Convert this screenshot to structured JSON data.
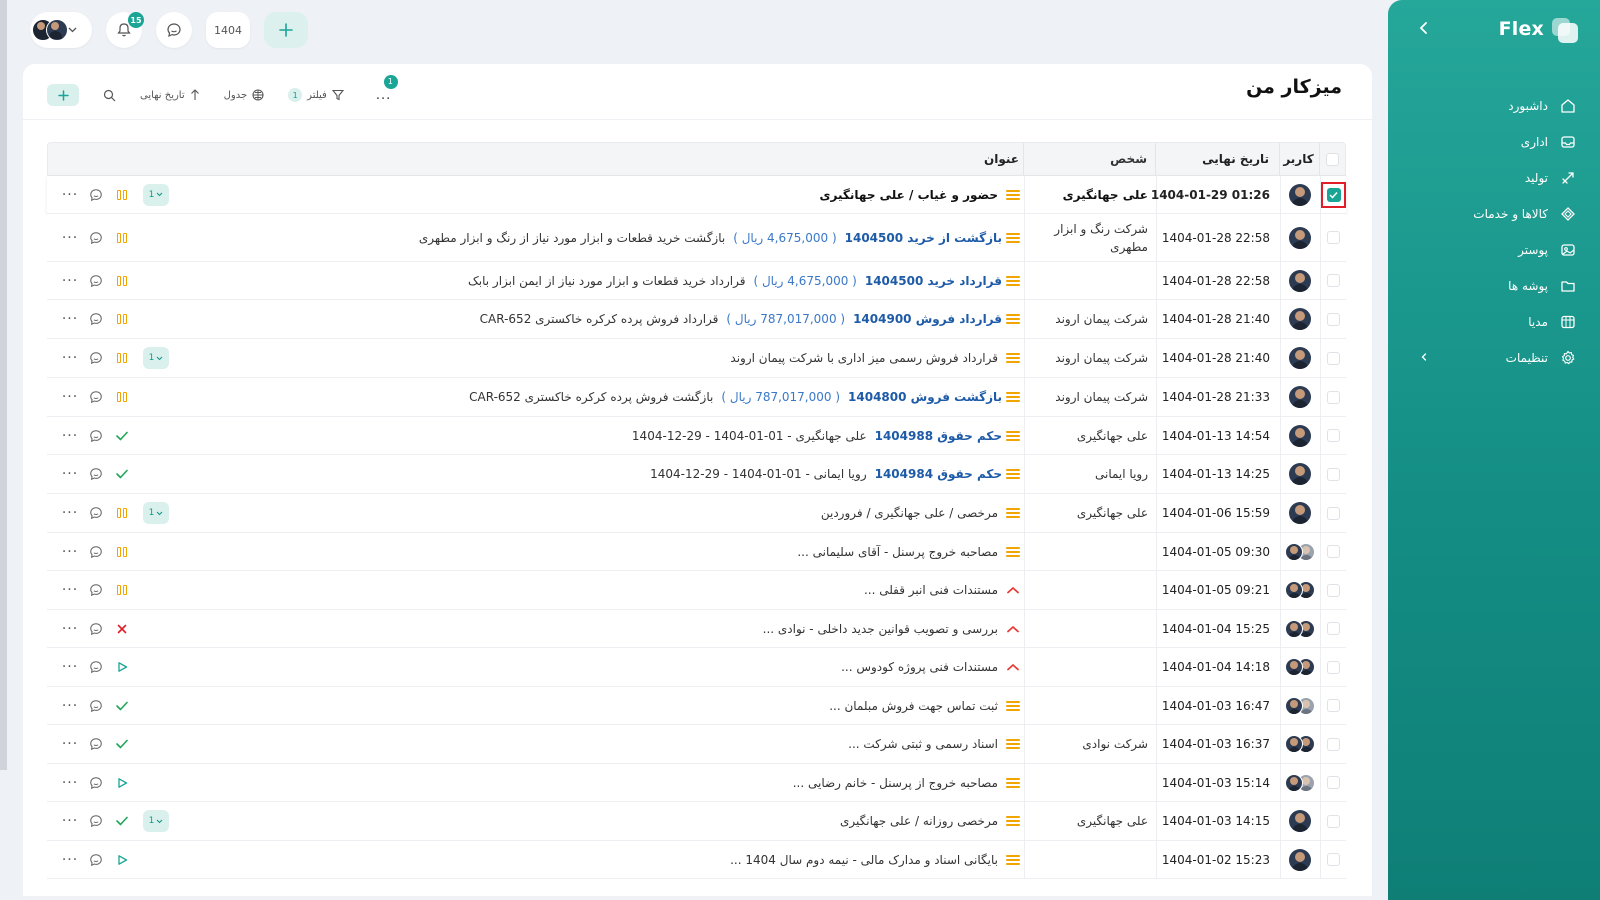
{
  "sidebar": {
    "logo": "Flex",
    "items": [
      {
        "label": "داشبورد",
        "icon": "home-icon"
      },
      {
        "label": "اداری",
        "icon": "inbox-icon"
      },
      {
        "label": "تولید",
        "icon": "production-icon"
      },
      {
        "label": "کالاها و خدمات",
        "icon": "boxes-icon"
      },
      {
        "label": "پوستر",
        "icon": "image-icon"
      },
      {
        "label": "پوشه ها",
        "icon": "folder-icon"
      },
      {
        "label": "مدیا",
        "icon": "media-icon"
      },
      {
        "label": "تنظیمات",
        "icon": "gear-icon"
      }
    ]
  },
  "topbar": {
    "notifications_count": "15",
    "year": "1404"
  },
  "page": {
    "title": "میزکار من"
  },
  "toolbar": {
    "sort_label": "تاریخ نهایی",
    "view_label": "جدول",
    "filter_label": "فیلتر",
    "filter_count": "1",
    "more_label": "...",
    "more_badge": "1"
  },
  "table": {
    "headers": {
      "user": "کاربر",
      "date": "تاریخ نهایی",
      "person": "شخص",
      "title": "عنوان"
    },
    "rows": [
      {
        "date": "1404-01-29 01:26",
        "person": "علی جهانگیری",
        "title": "حضور و غیاب / علی جهانگیری",
        "status": "pause",
        "sub": "1",
        "selected": true,
        "bold": true
      },
      {
        "date": "1404-01-28 22:58",
        "person": "شرکت رنگ و ابزار مطهری",
        "link": "بازگشت از خرید 1404500",
        "amount": "( 4,675,000 ریال )",
        "title": "بازگشت خرید قطعات و ابزار مورد نیاز از رنگ و ابزار مطهری",
        "status": "pause"
      },
      {
        "date": "1404-01-28 22:58",
        "person": "",
        "link": "قرارداد خرید 1404500",
        "amount": "( 4,675,000 ریال )",
        "title": "قرارداد خرید قطعات و ابزار مورد نیاز از ایمن ابزار بابک",
        "status": "pause"
      },
      {
        "date": "1404-01-28 21:40",
        "person": "شرکت پیمان اروند",
        "link": "قرارداد فروش 1404900",
        "amount": "( 787,017,000 ریال )",
        "title": "قرارداد فروش پرده کرکره خاکستری CAR-652",
        "status": "pause"
      },
      {
        "date": "1404-01-28 21:40",
        "person": "شرکت پیمان اروند",
        "title": "قرارداد فروش رسمی میز اداری با شرکت پیمان اروند",
        "status": "pause",
        "sub": "1"
      },
      {
        "date": "1404-01-28 21:33",
        "person": "شرکت پیمان اروند",
        "link": "بازگشت فروش 1404800",
        "amount": "( 787,017,000 ریال )",
        "title": "بازگشت فروش پرده کرکره خاکستری CAR-652",
        "status": "pause"
      },
      {
        "date": "1404-01-13 14:54",
        "person": "علی جهانگیری",
        "link": "حکم حقوق 1404988",
        "title": "علی جهانگیری - 01-01-1404 - 29-12-1404",
        "status": "check"
      },
      {
        "date": "1404-01-13 14:25",
        "person": "رویا ایمانی",
        "link": "حکم حقوق 1404984",
        "title": "رویا ایمانی - 01-01-1404 - 29-12-1404",
        "status": "check"
      },
      {
        "date": "1404-01-06 15:59",
        "person": "علی جهانگیری",
        "title": "مرخصی / علی جهانگیری / فروردین",
        "status": "pause",
        "sub": "1"
      },
      {
        "date": "1404-01-05 09:30",
        "person": "",
        "title": "مصاحبه خروج پرسنل - آقای سلیمانی ...",
        "status": "pause",
        "pair": true,
        "grey": true
      },
      {
        "date": "1404-01-05 09:21",
        "person": "",
        "title": "مستندات فنی انبر قفلی ...",
        "status": "pause",
        "pair": true,
        "prio": "up"
      },
      {
        "date": "1404-01-04 15:25",
        "person": "",
        "title": "بررسی و تصویب قوانین جدید داخلی - نوادی ...",
        "status": "cross",
        "pair": true,
        "prio": "up"
      },
      {
        "date": "1404-01-04 14:18",
        "person": "",
        "title": "مستندات فنی پروژه کودوس ...",
        "status": "play",
        "pair": true,
        "prio": "up"
      },
      {
        "date": "1404-01-03 16:47",
        "person": "",
        "title": "ثبت تماس جهت فروش مبلمان ...",
        "status": "check",
        "pair": true,
        "grey": true
      },
      {
        "date": "1404-01-03 16:37",
        "person": "شرکت نوادی",
        "title": "اسناد رسمی و ثبتی شرکت ...",
        "status": "check",
        "pair": true
      },
      {
        "date": "1404-01-03 15:14",
        "person": "",
        "title": "مصاحبه خروج از پرسنل - خانم رضایی ...",
        "status": "play",
        "pair": true,
        "grey": true
      },
      {
        "date": "1404-01-03 14:15",
        "person": "علی جهانگیری",
        "title": "مرخصی روزانه / علی جهانگیری",
        "status": "check",
        "sub": "1"
      },
      {
        "date": "1404-01-02 15:23",
        "person": "",
        "title": "بایگانی اسناد و مدارک مالی - نیمه دوم سال 1404 ...",
        "status": "play"
      }
    ]
  },
  "colors": {
    "accent": "#1aa596",
    "link": "#1d5aa8",
    "priority": "#f0a500",
    "danger": "#e11d2a"
  }
}
